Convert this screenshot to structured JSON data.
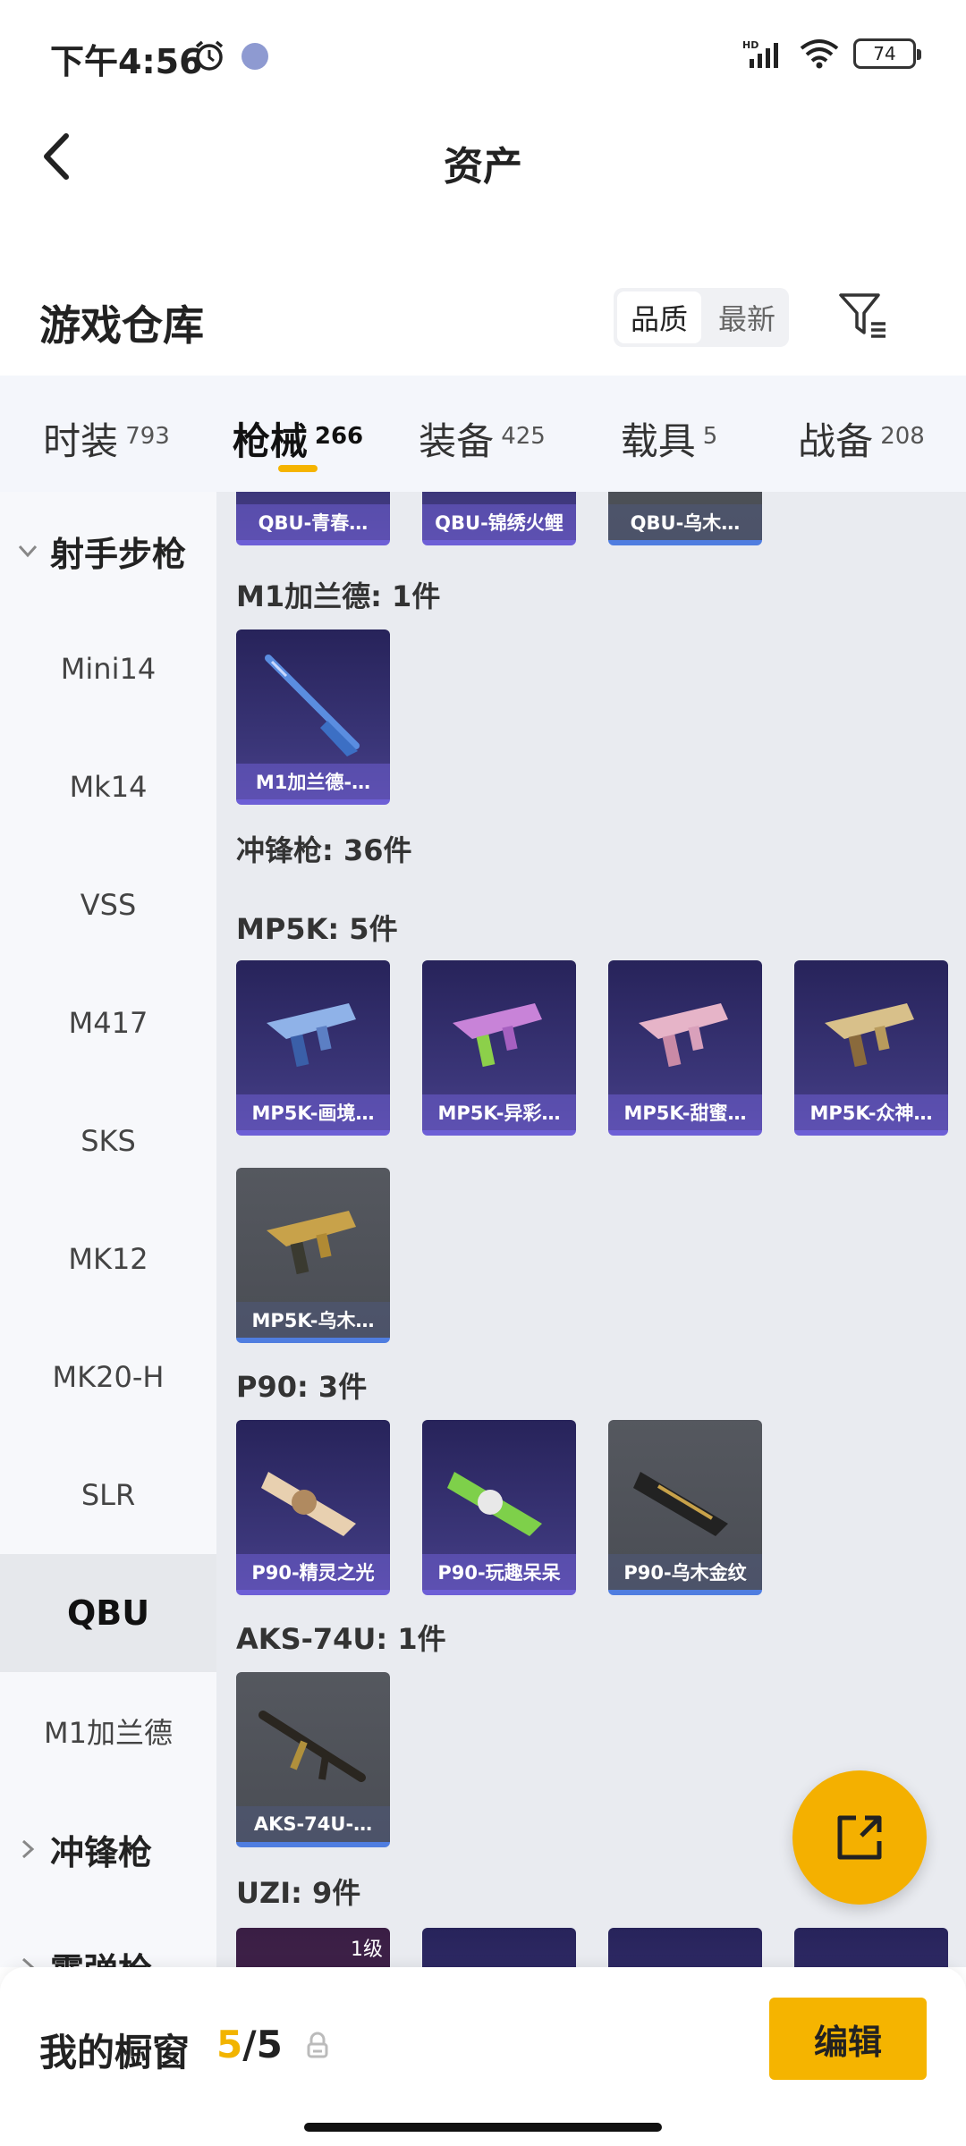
{
  "status_bar": {
    "time": "下午4:56",
    "battery": "74"
  },
  "header": {
    "title": "资产"
  },
  "warehouse": {
    "title": "游戏仓库",
    "sort_options": [
      "品质",
      "最新"
    ],
    "active_sort": "品质"
  },
  "tabs": [
    {
      "label": "时装",
      "count": "793"
    },
    {
      "label": "枪械",
      "count": "266",
      "active": true
    },
    {
      "label": "装备",
      "count": "425"
    },
    {
      "label": "载具",
      "count": "5"
    },
    {
      "label": "战备",
      "count": "208"
    }
  ],
  "sidebar": {
    "group_rifle": "射手步枪",
    "items": [
      "Mini14",
      "Mk14",
      "VSS",
      "M417",
      "SKS",
      "MK12",
      "MK20-H",
      "SLR",
      "QBU",
      "M1加兰德"
    ],
    "active_item": "QBU",
    "group_smg": "冲锋枪",
    "group_shotgun": "霰弹枪"
  },
  "content": {
    "qbu_cards": [
      "QBU-青春…",
      "QBU-锦绣火鲤",
      "QBU-乌木…"
    ],
    "m1_label": "M1加兰德: 1件",
    "m1_cards": [
      "M1加兰德-…"
    ],
    "smg_label": "冲锋枪: 36件",
    "mp5k_label": "MP5K: 5件",
    "mp5k_cards": [
      "MP5K-画境…",
      "MP5K-异彩…",
      "MP5K-甜蜜…",
      "MP5K-众神…",
      "MP5K-乌木…"
    ],
    "p90_label": "P90: 3件",
    "p90_cards": [
      "P90-精灵之光",
      "P90-玩趣呆呆",
      "P90-乌木金纹"
    ],
    "aks_label": "AKS-74U: 1件",
    "aks_cards": [
      "AKS-74U-…"
    ],
    "uzi_label": "UZI: 9件",
    "uzi_level": "1级"
  },
  "bottom_bar": {
    "showcase_label": "我的橱窗",
    "showcase_current": "5",
    "showcase_total": "/5",
    "edit_label": "编辑"
  },
  "colors": {
    "accent": "#f5b400",
    "card_purple": "#3b3679",
    "card_gray": "#4a4d54"
  }
}
